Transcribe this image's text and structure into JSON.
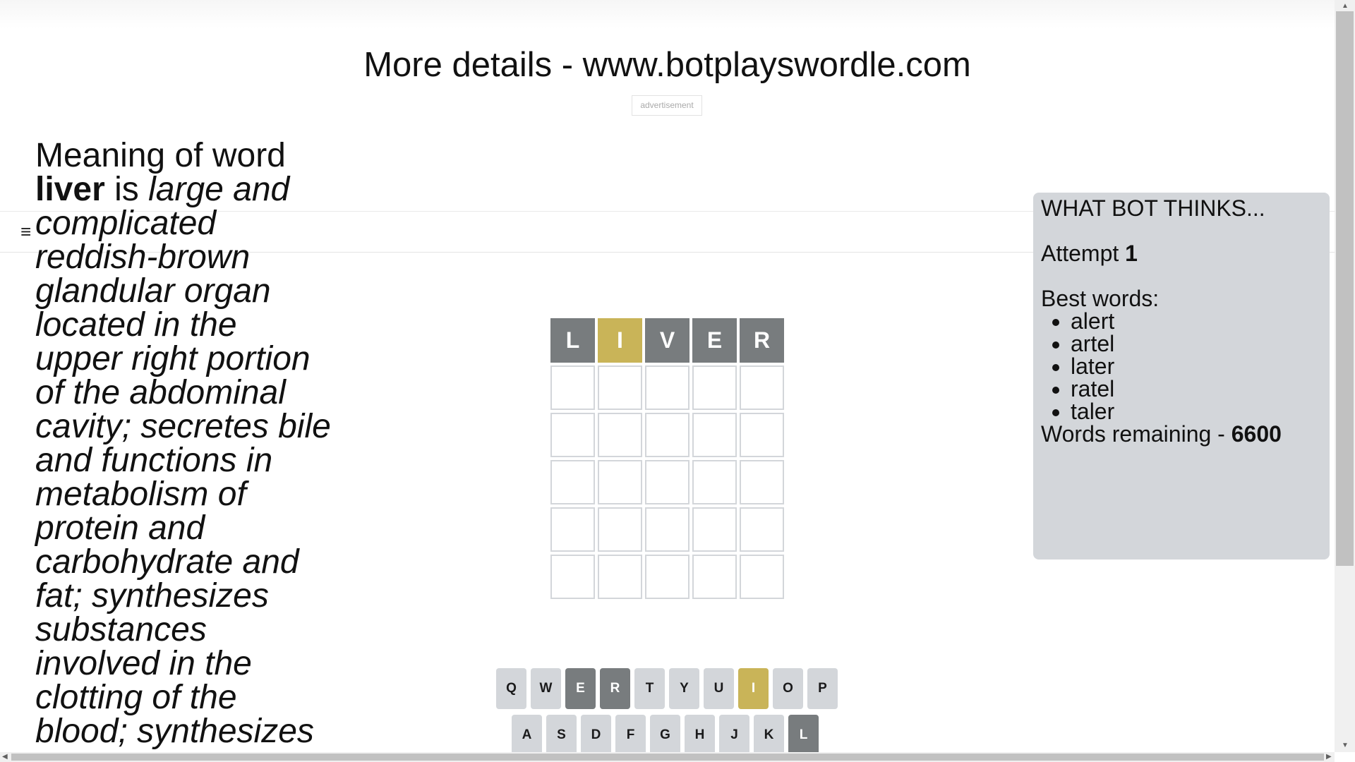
{
  "header": {
    "title": "More details - www.botplayswordle.com",
    "ad_label": "advertisement"
  },
  "nav": {
    "menu_icon": "≡"
  },
  "meaning": {
    "prefix": "Meaning of word",
    "word": "liver",
    "connector": " is ",
    "definition": "large and complicated reddish-brown glandular organ located in the upper right portion of the abdominal cavity; secretes bile and functions in metabolism of protein and carbohydrate and fat; synthesizes substances involved in the clotting of the blood; synthesizes"
  },
  "board": {
    "rows": [
      [
        {
          "letter": "L",
          "state": "absent"
        },
        {
          "letter": "I",
          "state": "present"
        },
        {
          "letter": "V",
          "state": "absent"
        },
        {
          "letter": "E",
          "state": "absent"
        },
        {
          "letter": "R",
          "state": "absent"
        }
      ],
      [
        {
          "letter": "",
          "state": "empty"
        },
        {
          "letter": "",
          "state": "empty"
        },
        {
          "letter": "",
          "state": "empty"
        },
        {
          "letter": "",
          "state": "empty"
        },
        {
          "letter": "",
          "state": "empty"
        }
      ],
      [
        {
          "letter": "",
          "state": "empty"
        },
        {
          "letter": "",
          "state": "empty"
        },
        {
          "letter": "",
          "state": "empty"
        },
        {
          "letter": "",
          "state": "empty"
        },
        {
          "letter": "",
          "state": "empty"
        }
      ],
      [
        {
          "letter": "",
          "state": "empty"
        },
        {
          "letter": "",
          "state": "empty"
        },
        {
          "letter": "",
          "state": "empty"
        },
        {
          "letter": "",
          "state": "empty"
        },
        {
          "letter": "",
          "state": "empty"
        }
      ],
      [
        {
          "letter": "",
          "state": "empty"
        },
        {
          "letter": "",
          "state": "empty"
        },
        {
          "letter": "",
          "state": "empty"
        },
        {
          "letter": "",
          "state": "empty"
        },
        {
          "letter": "",
          "state": "empty"
        }
      ],
      [
        {
          "letter": "",
          "state": "empty"
        },
        {
          "letter": "",
          "state": "empty"
        },
        {
          "letter": "",
          "state": "empty"
        },
        {
          "letter": "",
          "state": "empty"
        },
        {
          "letter": "",
          "state": "empty"
        }
      ]
    ]
  },
  "keyboard": {
    "rows": [
      [
        {
          "key": "Q",
          "state": "unused"
        },
        {
          "key": "W",
          "state": "unused"
        },
        {
          "key": "E",
          "state": "absent"
        },
        {
          "key": "R",
          "state": "absent"
        },
        {
          "key": "T",
          "state": "unused"
        },
        {
          "key": "Y",
          "state": "unused"
        },
        {
          "key": "U",
          "state": "unused"
        },
        {
          "key": "I",
          "state": "present"
        },
        {
          "key": "O",
          "state": "unused"
        },
        {
          "key": "P",
          "state": "unused"
        }
      ],
      [
        {
          "key": "A",
          "state": "unused"
        },
        {
          "key": "S",
          "state": "unused"
        },
        {
          "key": "D",
          "state": "unused"
        },
        {
          "key": "F",
          "state": "unused"
        },
        {
          "key": "G",
          "state": "unused"
        },
        {
          "key": "H",
          "state": "unused"
        },
        {
          "key": "J",
          "state": "unused"
        },
        {
          "key": "K",
          "state": "unused"
        },
        {
          "key": "L",
          "state": "absent"
        }
      ]
    ]
  },
  "bot_panel": {
    "title": "WHAT BOT THINKS...",
    "attempt_label": "Attempt",
    "attempt_value": "1",
    "best_words_label": "Best words:",
    "best_words": [
      "alert",
      "artel",
      "later",
      "ratel",
      "taler"
    ],
    "remaining_label": "Words remaining - ",
    "remaining_value": "6600"
  },
  "colors": {
    "absent": "#787c7e",
    "present": "#c9b458",
    "correct": "#6aaa64",
    "key_default": "#d3d6da",
    "panel_bg": "#d3d6da"
  }
}
